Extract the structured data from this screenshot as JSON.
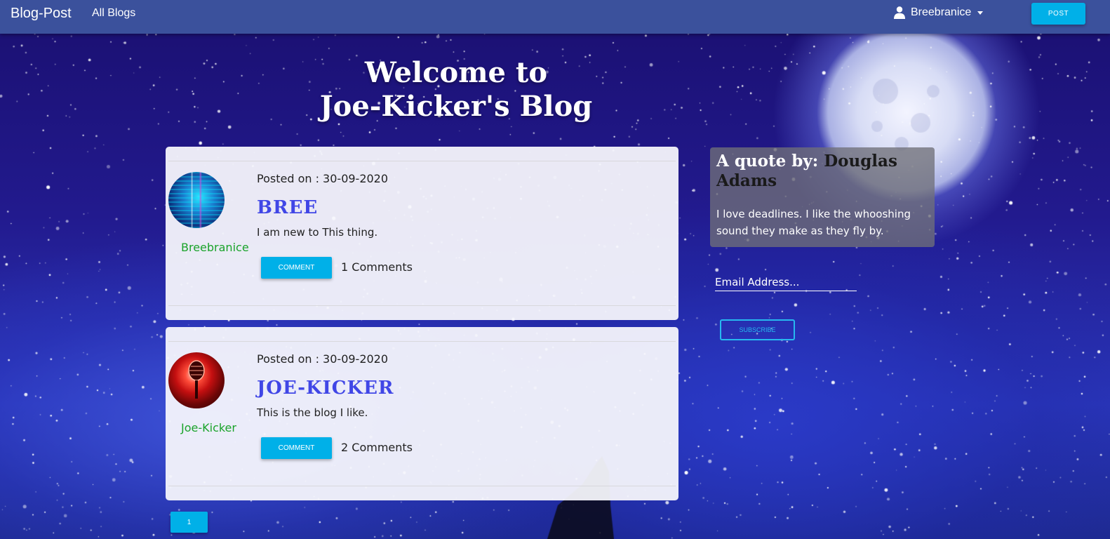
{
  "navbar": {
    "brand": "Blog-Post",
    "all_blogs_link": "All Blogs",
    "username": "Breebranice",
    "post_button": "POST"
  },
  "hero": {
    "line1": "Welcome to",
    "line2": "Joe-Kicker's Blog"
  },
  "posts": [
    {
      "author": "Breebranice",
      "posted_on": "Posted on : 30-09-2020",
      "title": "BREE",
      "body": "I am new to This thing.",
      "comment_button": "COMMENT",
      "comments": "1 Comments",
      "avatar_icon": "code-screen-image"
    },
    {
      "author": "Joe-Kicker",
      "posted_on": "Posted on : 30-09-2020",
      "title": "JOE-KICKER",
      "body": "This is the blog I like.",
      "comment_button": "COMMENT",
      "comments": "2 Comments",
      "avatar_icon": "microphone-image"
    }
  ],
  "pagination": {
    "current_page": "1"
  },
  "quote": {
    "prefix": "A quote by: ",
    "author": "Douglas Adams",
    "text": "I love deadlines. I like the whooshing sound they make as they fly by."
  },
  "subscribe": {
    "email_placeholder": "Email Address...",
    "button": "SUBSCRIBE"
  },
  "colors": {
    "navbar": "#3b519c",
    "accent_button": "#00b0e8",
    "post_title": "#4046e6",
    "author_name": "#1aa32a"
  }
}
